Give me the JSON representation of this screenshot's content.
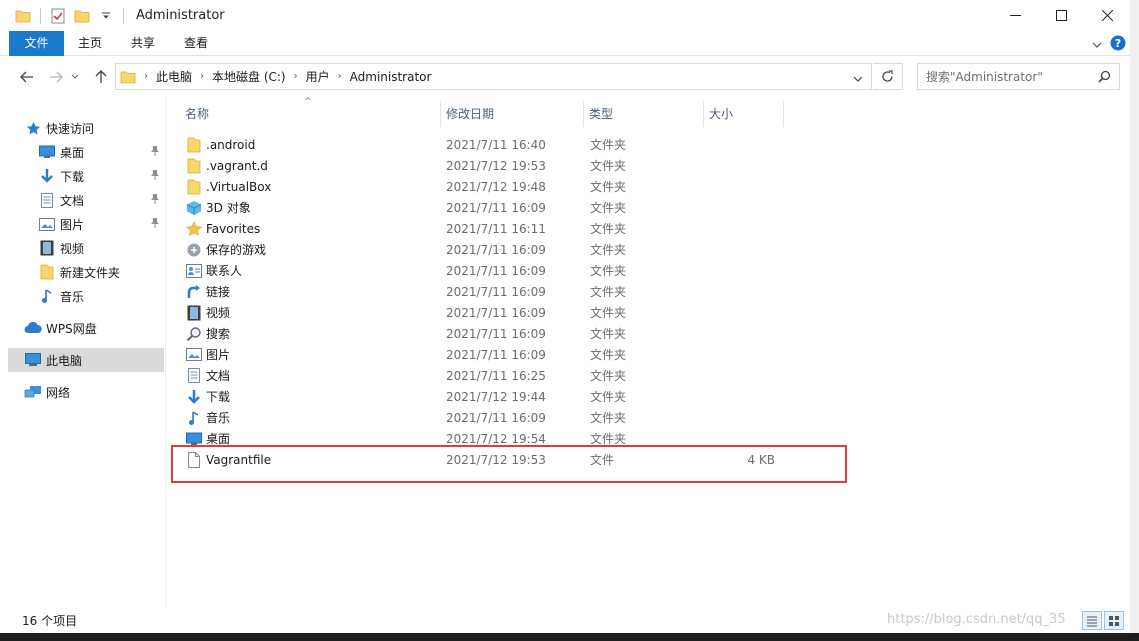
{
  "window": {
    "title": "Administrator"
  },
  "ribbon": {
    "tabs": [
      "文件",
      "主页",
      "共享",
      "查看"
    ]
  },
  "address": {
    "breadcrumbs": [
      "此电脑",
      "本地磁盘 (C:)",
      "用户",
      "Administrator"
    ]
  },
  "search": {
    "placeholder": "搜索\"Administrator\""
  },
  "sidebar": {
    "items": [
      {
        "label": "快速访问",
        "icon": "star-icon"
      },
      {
        "label": "桌面",
        "icon": "desktop-icon",
        "pinned": true
      },
      {
        "label": "下载",
        "icon": "download-icon",
        "pinned": true
      },
      {
        "label": "文档",
        "icon": "document-icon",
        "pinned": true
      },
      {
        "label": "图片",
        "icon": "picture-icon",
        "pinned": true
      },
      {
        "label": "视频",
        "icon": "video-icon"
      },
      {
        "label": "新建文件夹",
        "icon": "folder-icon"
      },
      {
        "label": "音乐",
        "icon": "music-icon"
      },
      {
        "label": "WPS网盘",
        "icon": "cloud-icon"
      },
      {
        "label": "此电脑",
        "icon": "computer-icon",
        "selected": true
      },
      {
        "label": "网络",
        "icon": "network-icon"
      }
    ]
  },
  "columns": {
    "name": "名称",
    "date": "修改日期",
    "type": "类型",
    "size": "大小"
  },
  "files": [
    {
      "name": ".android",
      "date": "2021/7/11 16:40",
      "type": "文件夹",
      "size": "",
      "icon": "folder-icon"
    },
    {
      "name": ".vagrant.d",
      "date": "2021/7/12 19:53",
      "type": "文件夹",
      "size": "",
      "icon": "folder-icon"
    },
    {
      "name": ".VirtualBox",
      "date": "2021/7/12 19:48",
      "type": "文件夹",
      "size": "",
      "icon": "folder-icon"
    },
    {
      "name": "3D 对象",
      "date": "2021/7/11 16:09",
      "type": "文件夹",
      "size": "",
      "icon": "cube-icon"
    },
    {
      "name": "Favorites",
      "date": "2021/7/11 16:11",
      "type": "文件夹",
      "size": "",
      "icon": "star-icon"
    },
    {
      "name": "保存的游戏",
      "date": "2021/7/11 16:09",
      "type": "文件夹",
      "size": "",
      "icon": "gamepad-icon"
    },
    {
      "name": "联系人",
      "date": "2021/7/11 16:09",
      "type": "文件夹",
      "size": "",
      "icon": "contacts-icon"
    },
    {
      "name": "链接",
      "date": "2021/7/11 16:09",
      "type": "文件夹",
      "size": "",
      "icon": "link-icon"
    },
    {
      "name": "视频",
      "date": "2021/7/11 16:09",
      "type": "文件夹",
      "size": "",
      "icon": "video-icon"
    },
    {
      "name": "搜索",
      "date": "2021/7/11 16:09",
      "type": "文件夹",
      "size": "",
      "icon": "search-icon"
    },
    {
      "name": "图片",
      "date": "2021/7/11 16:09",
      "type": "文件夹",
      "size": "",
      "icon": "picture-icon"
    },
    {
      "name": "文档",
      "date": "2021/7/11 16:25",
      "type": "文件夹",
      "size": "",
      "icon": "document-icon"
    },
    {
      "name": "下载",
      "date": "2021/7/12 19:44",
      "type": "文件夹",
      "size": "",
      "icon": "download-icon"
    },
    {
      "name": "音乐",
      "date": "2021/7/11 16:09",
      "type": "文件夹",
      "size": "",
      "icon": "music-icon"
    },
    {
      "name": "桌面",
      "date": "2021/7/12 19:54",
      "type": "文件夹",
      "size": "",
      "icon": "desktop-icon"
    },
    {
      "name": "Vagrantfile",
      "date": "2021/7/12 19:53",
      "type": "文件",
      "size": "4 KB",
      "icon": "file-icon"
    }
  ],
  "status": {
    "count": "16 个项目"
  },
  "watermark": "https://blog.csdn.net/qq_35"
}
